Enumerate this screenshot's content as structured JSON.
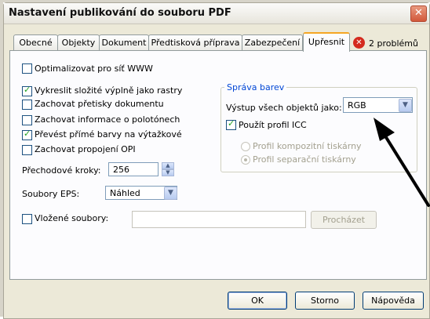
{
  "window": {
    "title": "Nastavení publikování do souboru PDF",
    "close_symbol": "✕"
  },
  "tabs": [
    {
      "label": "Obecné"
    },
    {
      "label": "Objekty"
    },
    {
      "label": "Dokument"
    },
    {
      "label": "Předtisková příprava"
    },
    {
      "label": "Zabezpečení"
    },
    {
      "label": "Upřesnit",
      "active": true
    }
  ],
  "issues": {
    "icon_symbol": "✕",
    "label": "2 problémů"
  },
  "options": {
    "optimize_web": {
      "label": "Optimalizovat pro síť WWW",
      "checked": false
    },
    "render_complex_fills": {
      "label": "Vykreslit složité výplně jako rastry",
      "checked": true
    },
    "keep_overprints": {
      "label": "Zachovat přetisky dokumentu",
      "checked": false
    },
    "keep_halftone": {
      "label": "Zachovat informace o polotónech",
      "checked": false
    },
    "convert_spot": {
      "label": "Převést přímé barvy na výtažkové",
      "checked": true
    },
    "keep_opi": {
      "label": "Zachovat propojení OPI",
      "checked": false
    }
  },
  "gradient_steps": {
    "label": "Přechodové kroky:",
    "value": "256"
  },
  "eps_files": {
    "label": "Soubory EPS:",
    "value": "Náhled"
  },
  "embedded_files": {
    "label": "Vložené soubory:",
    "checked": false,
    "value": ""
  },
  "browse_button": {
    "label": "Procházet"
  },
  "color_management": {
    "title": "Správa barev",
    "output_label": "Výstup všech objektů jako:",
    "output_value": "RGB",
    "use_icc": {
      "label": "Použít profil ICC",
      "checked": true
    },
    "composite_profile": {
      "label": "Profil kompozitní tiskárny",
      "selected": false
    },
    "separation_profile": {
      "label": "Profil separační tiskárny",
      "selected": true
    }
  },
  "buttons": {
    "ok": "OK",
    "cancel": "Storno",
    "help": "Nápověda"
  },
  "icons": {
    "dropdown": "▼",
    "spin_up": "▲",
    "spin_down": "▼"
  },
  "colors": {
    "accent_tab": "#f5a623",
    "group_title": "#0046d5",
    "error": "#d42a1e",
    "check": "#21a121"
  }
}
